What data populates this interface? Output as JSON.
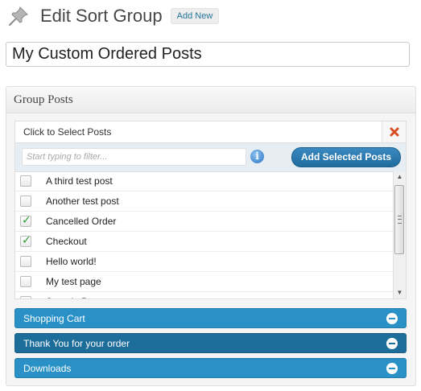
{
  "header": {
    "title": "Edit Sort Group",
    "add_new_label": "Add New"
  },
  "title_field": {
    "value": "My Custom Ordered Posts"
  },
  "group_posts": {
    "title": "Group Posts",
    "selector": {
      "heading": "Click to Select Posts",
      "filter_placeholder": "Start typing to filter...",
      "add_button_label": "Add Selected Posts",
      "posts": [
        {
          "title": "A third test post",
          "checked": false
        },
        {
          "title": "Another test post",
          "checked": false
        },
        {
          "title": "Cancelled Order",
          "checked": true
        },
        {
          "title": "Checkout",
          "checked": true
        },
        {
          "title": "Hello world!",
          "checked": false
        },
        {
          "title": "My test page",
          "checked": false
        },
        {
          "title": "Sample Page",
          "checked": false
        }
      ]
    },
    "selected_items": [
      {
        "label": "Shopping Cart",
        "state": "normal"
      },
      {
        "label": "Thank You for your order",
        "state": "active"
      },
      {
        "label": "Downloads",
        "state": "normal"
      }
    ]
  },
  "icons": {
    "pin": "pushpin-icon",
    "close": "close-icon",
    "info": "info-icon",
    "remove": "minus-circle-icon",
    "scroll_up": "scroll-up-arrow-icon",
    "scroll_down": "scroll-down-arrow-icon"
  },
  "colors": {
    "accent": "#2a91c7",
    "accent_active": "#1d6d9a",
    "link": "#21759b",
    "check": "#2f9a35",
    "close": "#d54e21"
  }
}
